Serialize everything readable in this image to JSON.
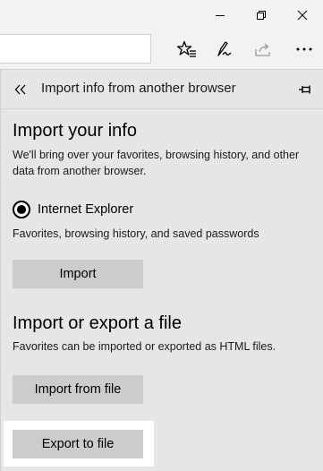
{
  "window": {
    "minimize_icon": "minimize-icon",
    "maximize_icon": "restore-icon",
    "close_icon": "close-icon"
  },
  "toolbar": {
    "address_value": "",
    "icons": [
      "favorites-star-icon",
      "pen-icon",
      "share-icon",
      "more-icon"
    ]
  },
  "panel": {
    "title": "Import info from another browser",
    "back_icon": "double-chevron-left-icon",
    "pin_icon": "pin-icon"
  },
  "import_section": {
    "heading": "Import your info",
    "description": "We'll bring over your favorites, browsing history, and other data from another browser.",
    "browser_option": "Internet Explorer",
    "browser_selected": true,
    "browser_details": "Favorites, browsing history, and saved passwords",
    "import_button": "Import"
  },
  "file_section": {
    "heading": "Import or export a file",
    "description": "Favorites can be imported or exported as HTML files.",
    "import_file_button": "Import from file",
    "export_file_button": "Export to file"
  },
  "colors": {
    "panel_bg": "#e6e6e6",
    "button_bg": "#cccccc",
    "chrome_bg": "#f2f2f2",
    "focus_highlight": "#ffffff"
  }
}
